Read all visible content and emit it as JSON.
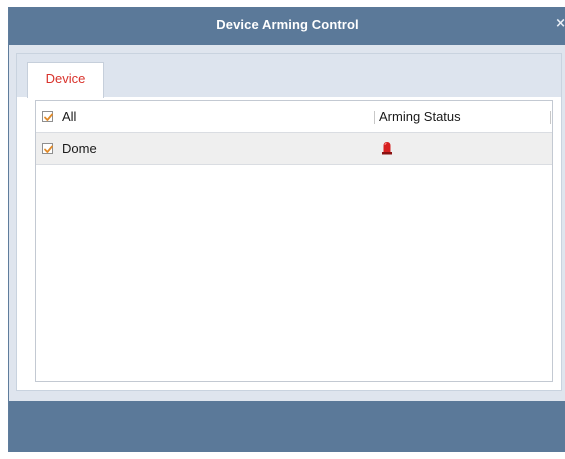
{
  "dialog": {
    "title": "Device Arming Control",
    "close_label": "×"
  },
  "tabs": [
    {
      "label": "Device",
      "active": true
    }
  ],
  "table": {
    "header": {
      "select_all_label": "All",
      "select_all_checked": true,
      "status_column": "Arming Status"
    },
    "rows": [
      {
        "name": "Dome",
        "checked": true,
        "arming_status_icon": "alarm-siren-icon"
      }
    ]
  },
  "colors": {
    "titlebar": "#5b7999",
    "dialog_bg": "#dfe5ee",
    "tab_text": "#d9322b",
    "check_mark": "#e08a2a",
    "selected_row": "#efefef",
    "alarm": "#d62020"
  }
}
